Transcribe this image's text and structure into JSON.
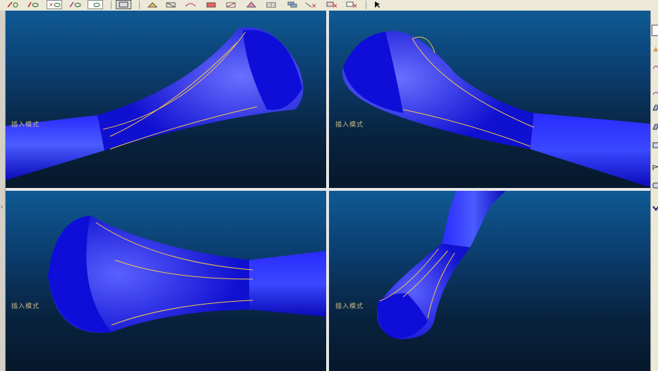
{
  "toolbar": {
    "buttons": [
      {
        "name": "sketch-line-icon"
      },
      {
        "name": "eye-icon"
      },
      {
        "name": "line-visibility-icon"
      },
      {
        "name": "hide-icon"
      },
      {
        "name": "view-eye-icon"
      },
      {
        "name": "screen-frame-icon"
      },
      {
        "name": "shaded-view-icon"
      },
      {
        "name": "wireframe-view-icon"
      },
      {
        "name": "curve-icon"
      },
      {
        "name": "surface-icon"
      },
      {
        "name": "render-icon"
      },
      {
        "name": "edit-surface-icon"
      },
      {
        "name": "mesh-icon"
      },
      {
        "name": "layer-icon"
      },
      {
        "name": "delete-edge-icon"
      },
      {
        "name": "delete-surface-icon"
      },
      {
        "name": "delete-curve-icon"
      },
      {
        "name": "select-arrow-icon"
      }
    ]
  },
  "viewports": [
    {
      "id": "top-left",
      "mode_label": "插入模式"
    },
    {
      "id": "top-right",
      "mode_label": "插入模式"
    },
    {
      "id": "bottom-left",
      "mode_label": "插入模式"
    },
    {
      "id": "bottom-right",
      "mode_label": "插入模式"
    }
  ],
  "right_panel": {
    "icons": [
      "selector-icon",
      "triangle-icon",
      "arc-icon",
      "arc-icon-2",
      "plane-icon",
      "plane-icon-2",
      "rect-icon",
      "flag-icon",
      "cylinder-icon",
      "chevron-icon"
    ]
  },
  "colors": {
    "model": "#1a1af0",
    "background_top": "#0f5a94",
    "background_bottom": "#06182b",
    "curve": "#f2c84a"
  }
}
